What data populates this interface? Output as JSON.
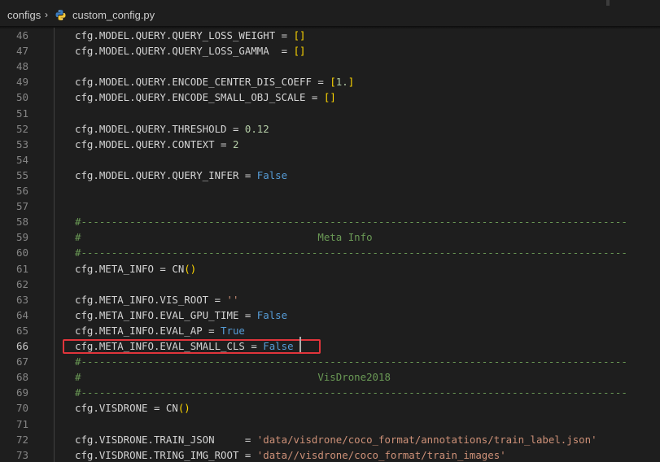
{
  "breadcrumb": {
    "folder": "configs",
    "separator": "›",
    "file": "custom_config.py",
    "file_icon": "python-icon"
  },
  "editor": {
    "active_line": 66,
    "colors": {
      "background": "#1e1e1e",
      "line_number": "#858585",
      "identifier": "#d4d4d4",
      "number": "#b5cea8",
      "keyword_bool": "#569cd6",
      "string": "#ce9178",
      "comment": "#6a9955",
      "bracket": "#ffd700",
      "highlight_box": "#e0353b"
    },
    "lines": [
      {
        "num": "46",
        "tokens": [
          {
            "t": "cfg.MODEL.QUERY.QUERY_LOSS_WEIGHT = ",
            "c": "id"
          },
          {
            "t": "[]",
            "c": "bracket"
          }
        ]
      },
      {
        "num": "47",
        "tokens": [
          {
            "t": "cfg.MODEL.QUERY.QUERY_LOSS_GAMMA  = ",
            "c": "id"
          },
          {
            "t": "[]",
            "c": "bracket"
          }
        ]
      },
      {
        "num": "48",
        "tokens": []
      },
      {
        "num": "49",
        "tokens": [
          {
            "t": "cfg.MODEL.QUERY.ENCODE_CENTER_DIS_COEFF = ",
            "c": "id"
          },
          {
            "t": "[",
            "c": "bracket"
          },
          {
            "t": "1.",
            "c": "num"
          },
          {
            "t": "]",
            "c": "bracket"
          }
        ]
      },
      {
        "num": "50",
        "tokens": [
          {
            "t": "cfg.MODEL.QUERY.ENCODE_SMALL_OBJ_SCALE = ",
            "c": "id"
          },
          {
            "t": "[]",
            "c": "bracket"
          }
        ]
      },
      {
        "num": "51",
        "tokens": []
      },
      {
        "num": "52",
        "tokens": [
          {
            "t": "cfg.MODEL.QUERY.THRESHOLD = ",
            "c": "id"
          },
          {
            "t": "0.12",
            "c": "num"
          }
        ]
      },
      {
        "num": "53",
        "tokens": [
          {
            "t": "cfg.MODEL.QUERY.CONTEXT = ",
            "c": "id"
          },
          {
            "t": "2",
            "c": "num"
          }
        ]
      },
      {
        "num": "54",
        "tokens": []
      },
      {
        "num": "55",
        "tokens": [
          {
            "t": "cfg.MODEL.QUERY.QUERY_INFER = ",
            "c": "id"
          },
          {
            "t": "False",
            "c": "bool"
          }
        ]
      },
      {
        "num": "56",
        "tokens": []
      },
      {
        "num": "57",
        "tokens": []
      },
      {
        "num": "58",
        "tokens": [
          {
            "t": "#------------------------------------------------------------------------------------------",
            "c": "comment"
          }
        ]
      },
      {
        "num": "59",
        "tokens": [
          {
            "t": "#                                       Meta Info",
            "c": "comment"
          }
        ]
      },
      {
        "num": "60",
        "tokens": [
          {
            "t": "#------------------------------------------------------------------------------------------",
            "c": "comment"
          }
        ]
      },
      {
        "num": "61",
        "tokens": [
          {
            "t": "cfg.META_INFO = CN",
            "c": "id"
          },
          {
            "t": "()",
            "c": "bracket"
          }
        ]
      },
      {
        "num": "62",
        "tokens": []
      },
      {
        "num": "63",
        "tokens": [
          {
            "t": "cfg.META_INFO.VIS_ROOT = ",
            "c": "id"
          },
          {
            "t": "''",
            "c": "str"
          }
        ]
      },
      {
        "num": "64",
        "tokens": [
          {
            "t": "cfg.META_INFO.EVAL_GPU_TIME = ",
            "c": "id"
          },
          {
            "t": "False",
            "c": "bool"
          }
        ]
      },
      {
        "num": "65",
        "tokens": [
          {
            "t": "cfg.META_INFO.EVAL_AP = ",
            "c": "id"
          },
          {
            "t": "True",
            "c": "bool"
          }
        ]
      },
      {
        "num": "66",
        "tokens": [
          {
            "t": "cfg.META_INFO.EVAL_SMALL_CLS = ",
            "c": "id"
          },
          {
            "t": "False",
            "c": "bool"
          }
        ]
      },
      {
        "num": "67",
        "tokens": [
          {
            "t": "#------------------------------------------------------------------------------------------",
            "c": "comment"
          }
        ]
      },
      {
        "num": "68",
        "tokens": [
          {
            "t": "#                                       VisDrone2018",
            "c": "comment"
          }
        ]
      },
      {
        "num": "69",
        "tokens": [
          {
            "t": "#------------------------------------------------------------------------------------------",
            "c": "comment"
          }
        ]
      },
      {
        "num": "70",
        "tokens": [
          {
            "t": "cfg.VISDRONE = CN",
            "c": "id"
          },
          {
            "t": "()",
            "c": "bracket"
          }
        ]
      },
      {
        "num": "71",
        "tokens": []
      },
      {
        "num": "72",
        "tokens": [
          {
            "t": "cfg.VISDRONE.TRAIN_JSON     = ",
            "c": "id"
          },
          {
            "t": "'data/visdrone/coco_format/annotations/train_label.json'",
            "c": "str"
          }
        ]
      },
      {
        "num": "73",
        "tokens": [
          {
            "t": "cfg.VISDRONE.TRING_IMG_ROOT = ",
            "c": "id"
          },
          {
            "t": "'data//visdrone/coco_format/train_images'",
            "c": "str"
          }
        ]
      }
    ]
  }
}
